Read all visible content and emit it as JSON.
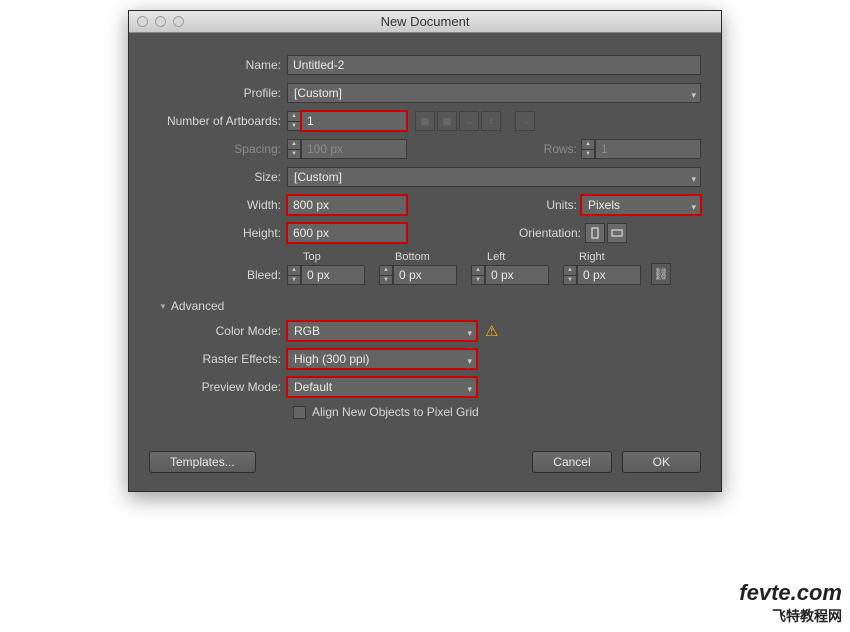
{
  "dialog": {
    "title": "New Document",
    "name_label": "Name:",
    "name_value": "Untitled-2",
    "profile_label": "Profile:",
    "profile_value": "[Custom]",
    "artboards_label": "Number of Artboards:",
    "artboards_value": "1",
    "spacing_label": "Spacing:",
    "spacing_value": "100 px",
    "rows_label": "Rows:",
    "rows_value": "1",
    "size_label": "Size:",
    "size_value": "[Custom]",
    "width_label": "Width:",
    "width_value": "800 px",
    "units_label": "Units:",
    "units_value": "Pixels",
    "height_label": "Height:",
    "height_value": "600 px",
    "orientation_label": "Orientation:",
    "bleed_label": "Bleed:",
    "bleed_top_label": "Top",
    "bleed_bottom_label": "Bottom",
    "bleed_left_label": "Left",
    "bleed_right_label": "Right",
    "bleed_value": "0 px",
    "advanced_label": "Advanced",
    "colormode_label": "Color Mode:",
    "colormode_value": "RGB",
    "raster_label": "Raster Effects:",
    "raster_value": "High (300 ppi)",
    "preview_label": "Preview Mode:",
    "preview_value": "Default",
    "aligngrid_label": "Align New Objects to Pixel Grid",
    "templates_btn": "Templates...",
    "cancel_btn": "Cancel",
    "ok_btn": "OK"
  },
  "watermark": {
    "line1": "fevte.com",
    "line2": "飞特教程网"
  }
}
